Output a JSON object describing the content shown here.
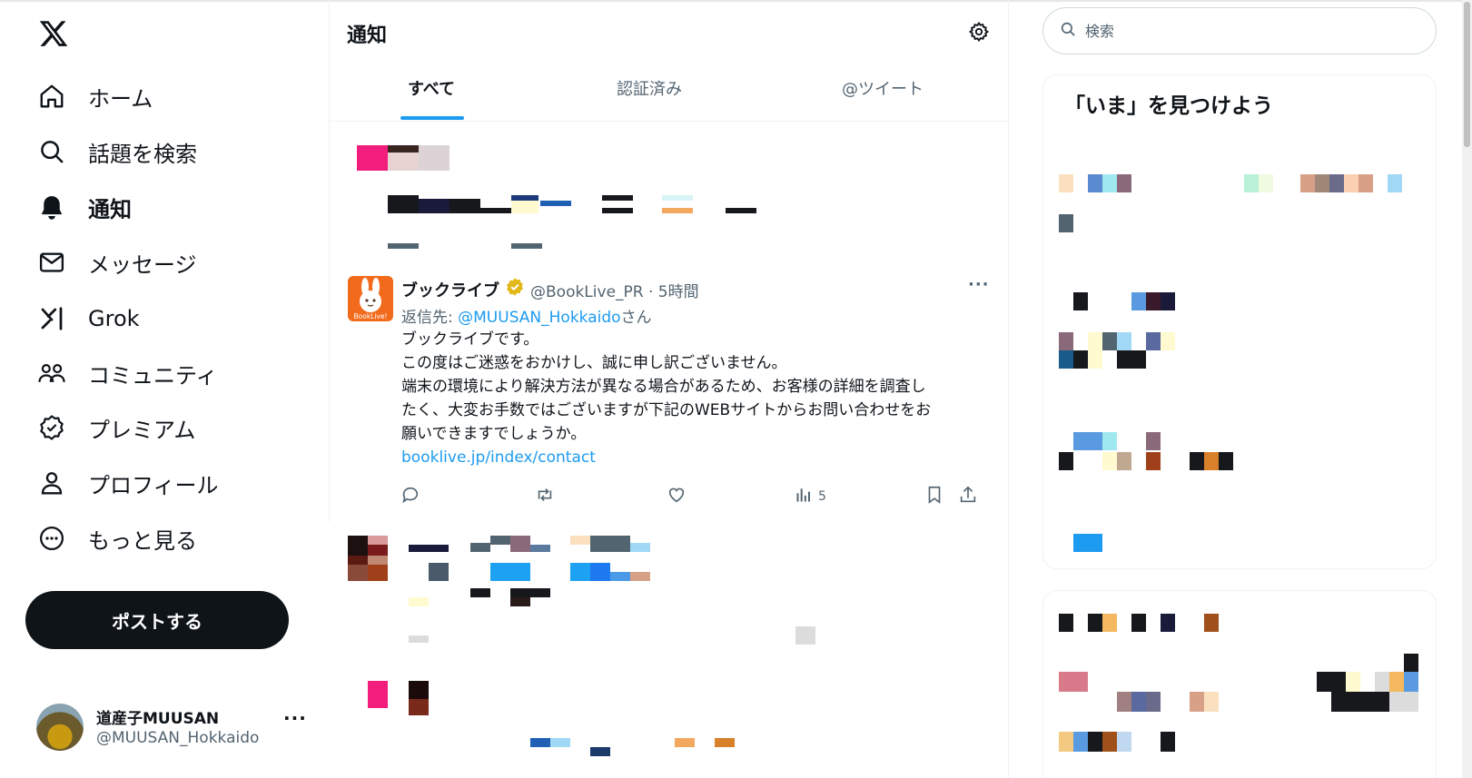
{
  "sidebar": {
    "logo": "x-logo",
    "items": [
      {
        "label": "ホーム",
        "icon": "home-icon"
      },
      {
        "label": "話題を検索",
        "icon": "search-icon"
      },
      {
        "label": "通知",
        "icon": "bell-icon",
        "active": true
      },
      {
        "label": "メッセージ",
        "icon": "mail-icon"
      },
      {
        "label": "Grok",
        "icon": "grok-icon"
      },
      {
        "label": "コミュニティ",
        "icon": "community-icon"
      },
      {
        "label": "プレミアム",
        "icon": "verified-badge-icon"
      },
      {
        "label": "プロフィール",
        "icon": "person-icon"
      },
      {
        "label": "もっと見る",
        "icon": "more-circle-icon"
      }
    ],
    "post_button": "ポストする",
    "account": {
      "name": "道産子MUUSAN",
      "handle": "@MUUSAN_Hokkaido",
      "more": "···"
    }
  },
  "main": {
    "title": "通知",
    "tabs": [
      {
        "label": "すべて",
        "active": true
      },
      {
        "label": "認証済み"
      },
      {
        "label": "@ツイート"
      }
    ],
    "tweet": {
      "name": "ブックライブ",
      "avatar_text": "BookLive!",
      "handle": "@BookLive_PR",
      "time": "5時間",
      "meta": "@BookLive_PR · 5時間",
      "reply_prefix": "返信先: ",
      "reply_mention": "@MUUSAN_Hokkaido",
      "reply_suffix": "さん",
      "body_lines": [
        "ブックライブです。",
        "この度はご迷惑をおかけし、誠に申し訳ございません。",
        "端末の環境により解決方法が異なる場合があるため、お客様の詳細を調査し",
        "たく、大変お手数ではございますが下記のWEBサイトからお問い合わせをお",
        "願いできますでしょうか。"
      ],
      "link": "booklive.jp/index/contact",
      "views": "5",
      "more": "···"
    }
  },
  "right": {
    "search_placeholder": "検索",
    "trends_title": "「いま」を見つけよう"
  },
  "colors": {
    "accent": "#1d9bf0",
    "text": "#0f1419",
    "muted": "#536471",
    "verified": "#e2b719"
  }
}
